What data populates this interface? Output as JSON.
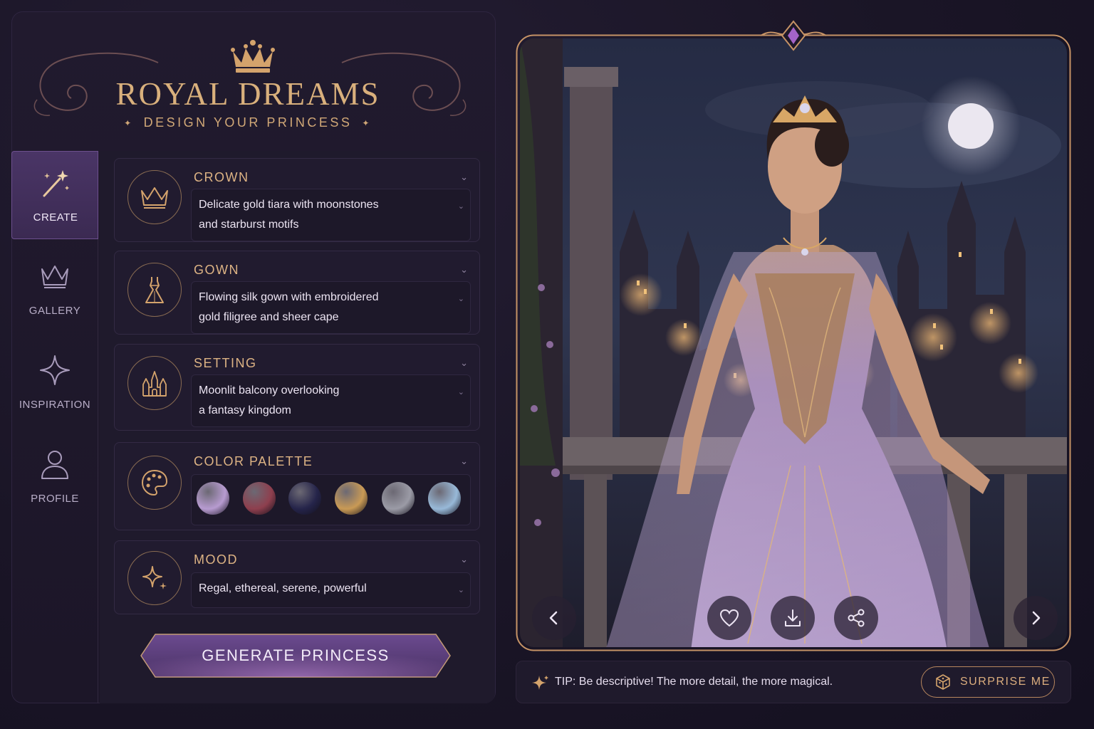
{
  "app": {
    "title": "ROYAL DREAMS",
    "subtitle": "DESIGN YOUR PRINCESS"
  },
  "nav": {
    "items": [
      {
        "label": "CREATE",
        "icon": "magic-wand-icon",
        "active": true
      },
      {
        "label": "GALLERY",
        "icon": "crown-icon",
        "active": false
      },
      {
        "label": "INSPIRATION",
        "icon": "sparkle-icon",
        "active": false
      },
      {
        "label": "PROFILE",
        "icon": "user-icon",
        "active": false
      }
    ]
  },
  "form": {
    "crown": {
      "title": "CROWN",
      "value": "Delicate gold tiara with moonstones and starburst motifs",
      "line1": "Delicate gold tiara with moonstones",
      "line2": "and starburst motifs"
    },
    "gown": {
      "title": "GOWN",
      "value": "Flowing silk gown with embroidered gold filigree and sheer cape",
      "line1": "Flowing silk gown with embroidered",
      "line2": "gold filigree and sheer cape"
    },
    "setting": {
      "title": "SETTING",
      "value": "Moonlit balcony overlooking a fantasy kingdom",
      "line1": "Moonlit balcony overlooking",
      "line2": "a fantasy kingdom"
    },
    "palette": {
      "title": "COLOR PALETTE",
      "swatches": [
        "#b79bd0",
        "#8e3f4e",
        "#25244a",
        "#c99a55",
        "#9b9ba6",
        "#98b9d8"
      ]
    },
    "mood": {
      "title": "MOOD",
      "value": "Regal, ethereal, serene, powerful"
    }
  },
  "generate_label": "GENERATE PRINCESS",
  "preview": {
    "controls": [
      "chevron-left-icon",
      "heart-icon",
      "download-icon",
      "share-icon",
      "chevron-right-icon"
    ]
  },
  "tip": {
    "text": "TIP: Be descriptive! The more detail, the more magical."
  },
  "surprise_label": "SURPRISE ME",
  "colors": {
    "gold": "#d9b07c",
    "accent_purple": "#6a4690",
    "background": "#1a1526"
  }
}
